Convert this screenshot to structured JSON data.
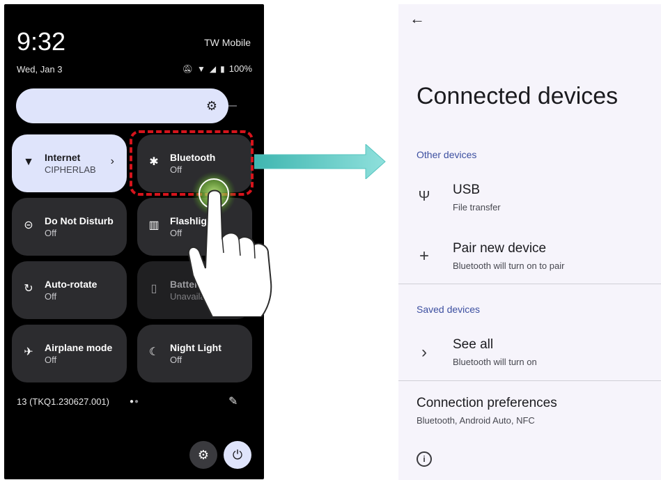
{
  "quick_settings": {
    "time": "9:32",
    "carrier": "TW Mobile",
    "date": "Wed, Jan 3",
    "battery": "100%",
    "status_icons": [
      "mute-icon",
      "wifi-icon",
      "signal-icon",
      "battery-icon"
    ],
    "tiles": [
      {
        "name": "Internet",
        "sub": "CIPHERLAB",
        "icon": "wifi-icon",
        "active": true
      },
      {
        "name": "Bluetooth",
        "sub": "Off",
        "icon": "bluetooth-icon",
        "active": false
      },
      {
        "name": "Do Not Disturb",
        "sub": "Off",
        "icon": "do-not-disturb-icon",
        "active": false
      },
      {
        "name": "Flashlight",
        "sub": "Off",
        "icon": "flashlight-icon",
        "active": false
      },
      {
        "name": "Auto-rotate",
        "sub": "Off",
        "icon": "auto-rotate-icon",
        "active": false
      },
      {
        "name": "Battery Saver",
        "sub": "Unavailable",
        "icon": "battery-saver-icon",
        "active": false
      },
      {
        "name": "Airplane mode",
        "sub": "Off",
        "icon": "airplane-icon",
        "active": false
      },
      {
        "name": "Night Light",
        "sub": "Off",
        "icon": "night-light-icon",
        "active": false
      }
    ],
    "build": "13 (TKQ1.230627.001)",
    "accent": "#dfe4fb",
    "highlight_color": "#d6141c"
  },
  "connected_devices": {
    "title": "Connected devices",
    "sections": {
      "other": "Other devices",
      "saved": "Saved devices"
    },
    "usb": {
      "title": "USB",
      "sub": "File transfer"
    },
    "pair": {
      "title": "Pair new device",
      "sub": "Bluetooth will turn on to pair"
    },
    "see_all": {
      "title": "See all",
      "sub": "Bluetooth will turn on"
    },
    "prefs": {
      "title": "Connection preferences",
      "sub": "Bluetooth, Android Auto, NFC"
    },
    "section_color": "#3c4fa0"
  }
}
